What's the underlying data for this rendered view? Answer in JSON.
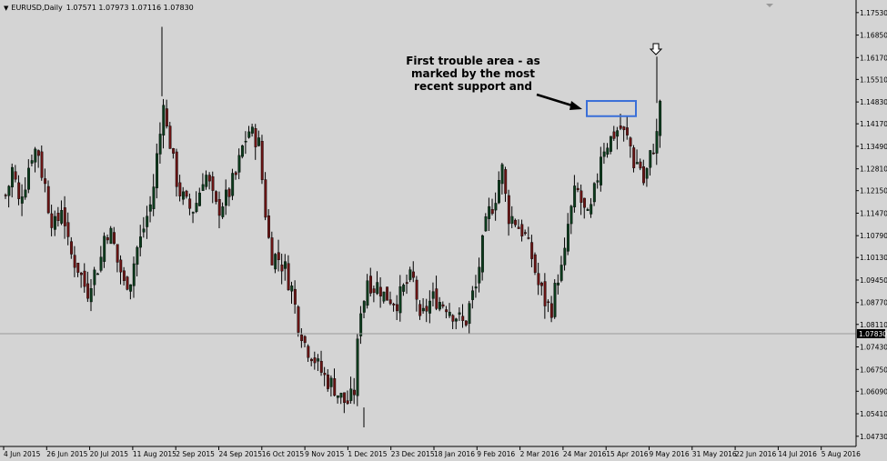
{
  "window": {
    "symbol_label": "EURUSD,Daily",
    "ohlc": [
      "1.07571",
      "1.07973",
      "1.07116",
      "1.07830"
    ]
  },
  "annotation": {
    "text": "First trouble area - as marked by the most recent support and"
  },
  "icons": {
    "arrow_down": "down-arrow-icon",
    "pointer_arrow": "pointer-arrow-icon",
    "title_triangle": "triangle-down-icon"
  },
  "colors": {
    "background": "#d4d4d4",
    "bull_candle": "#0b3b1c",
    "bear_candle": "#6a1414",
    "wick": "#000000",
    "highlight_box": "#3a6fd8",
    "current_price_line": "#9a9a9a",
    "current_price_tag": "#000000"
  },
  "chart_data": {
    "type": "candlestick",
    "symbol": "EURUSD",
    "timeframe": "Daily",
    "y_axis": {
      "range": [
        1.0445,
        1.178
      ],
      "tick_labels": [
        "1.17530",
        "1.16850",
        "1.16170",
        "1.15510",
        "1.14830",
        "1.14170",
        "1.13490",
        "1.12810",
        "1.12150",
        "1.11470",
        "1.10790",
        "1.10130",
        "1.09450",
        "1.08770",
        "1.08110",
        "1.07430",
        "1.06750",
        "1.06090",
        "1.05410",
        "1.04730"
      ]
    },
    "x_axis": {
      "tick_labels": [
        "4 Jun 2015",
        "26 Jun 2015",
        "20 Jul 2015",
        "11 Aug 2015",
        "2 Sep 2015",
        "24 Sep 2015",
        "16 Oct 2015",
        "9 Nov 2015",
        "1 Dec 2015",
        "23 Dec 2015",
        "18 Jan 2016",
        "9 Feb 2016",
        "2 Mar 2016",
        "24 Mar 2016",
        "15 Apr 2016",
        "9 May 2016",
        "31 May 2016",
        "22 Jun 2016",
        "14 Jul 2016",
        "5 Aug 2016"
      ]
    },
    "current_price": "1.07830",
    "highlight_zone": {
      "low": 1.1451,
      "high": 1.1475,
      "from": "24 Mar 2016",
      "to": "15 Apr 2016"
    },
    "close_path": [
      [
        0,
        1.12
      ],
      [
        5,
        1.128
      ],
      [
        10,
        1.118
      ],
      [
        15,
        1.124
      ],
      [
        20,
        1.132
      ],
      [
        25,
        1.135
      ],
      [
        30,
        1.125
      ],
      [
        35,
        1.115
      ],
      [
        40,
        1.11
      ],
      [
        45,
        1.117
      ],
      [
        50,
        1.105
      ],
      [
        55,
        1.1
      ],
      [
        60,
        1.097
      ],
      [
        65,
        1.09
      ],
      [
        70,
        1.096
      ],
      [
        75,
        1.099
      ],
      [
        80,
        1.11
      ],
      [
        85,
        1.108
      ],
      [
        90,
        1.1
      ],
      [
        95,
        1.093
      ],
      [
        100,
        1.095
      ],
      [
        105,
        1.103
      ],
      [
        110,
        1.109
      ],
      [
        115,
        1.115
      ],
      [
        120,
        1.125
      ],
      [
        125,
        1.142
      ],
      [
        126,
        1.161
      ],
      [
        127,
        1.15
      ],
      [
        130,
        1.14
      ],
      [
        135,
        1.13
      ],
      [
        140,
        1.121
      ],
      [
        145,
        1.118
      ],
      [
        150,
        1.115
      ],
      [
        155,
        1.12
      ],
      [
        160,
        1.127
      ],
      [
        165,
        1.122
      ],
      [
        170,
        1.115
      ],
      [
        175,
        1.118
      ],
      [
        180,
        1.121
      ],
      [
        185,
        1.126
      ],
      [
        190,
        1.133
      ],
      [
        195,
        1.14
      ],
      [
        200,
        1.138
      ],
      [
        205,
        1.135
      ],
      [
        210,
        1.11
      ],
      [
        215,
        1.102
      ],
      [
        220,
        1.101
      ],
      [
        225,
        1.098
      ],
      [
        230,
        1.092
      ],
      [
        235,
        1.083
      ],
      [
        240,
        1.076
      ],
      [
        245,
        1.073
      ],
      [
        250,
        1.07
      ],
      [
        255,
        1.066
      ],
      [
        260,
        1.064
      ],
      [
        265,
        1.062
      ],
      [
        270,
        1.059
      ],
      [
        275,
        1.057
      ],
      [
        280,
        1.06
      ],
      [
        283,
        1.063
      ],
      [
        285,
        1.086
      ],
      [
        288,
        1.087
      ],
      [
        292,
        1.095
      ],
      [
        296,
        1.092
      ],
      [
        300,
        1.093
      ],
      [
        305,
        1.09
      ],
      [
        310,
        1.089
      ],
      [
        315,
        1.088
      ],
      [
        320,
        1.091
      ],
      [
        325,
        1.095
      ],
      [
        330,
        1.094
      ],
      [
        333,
        1.08
      ],
      [
        336,
        1.083
      ],
      [
        340,
        1.087
      ],
      [
        345,
        1.089
      ],
      [
        350,
        1.088
      ],
      [
        355,
        1.087
      ],
      [
        360,
        1.085
      ],
      [
        365,
        1.083
      ],
      [
        370,
        1.081
      ],
      [
        375,
        1.088
      ],
      [
        380,
        1.093
      ],
      [
        385,
        1.108
      ],
      [
        390,
        1.115
      ],
      [
        395,
        1.12
      ],
      [
        400,
        1.128
      ],
      [
        405,
        1.114
      ],
      [
        410,
        1.113
      ],
      [
        415,
        1.11
      ],
      [
        420,
        1.107
      ],
      [
        425,
        1.1
      ],
      [
        430,
        1.093
      ],
      [
        435,
        1.088
      ],
      [
        440,
        1.086
      ],
      [
        445,
        1.095
      ],
      [
        450,
        1.099
      ],
      [
        455,
        1.114
      ],
      [
        460,
        1.122
      ],
      [
        465,
        1.117
      ],
      [
        470,
        1.112
      ],
      [
        475,
        1.121
      ],
      [
        480,
        1.133
      ],
      [
        485,
        1.136
      ],
      [
        490,
        1.138
      ],
      [
        495,
        1.141
      ],
      [
        500,
        1.138
      ],
      [
        505,
        1.134
      ],
      [
        508,
        1.128
      ],
      [
        510,
        1.132
      ],
      [
        515,
        1.124
      ],
      [
        518,
        1.129
      ],
      [
        521,
        1.133
      ],
      [
        524,
        1.136
      ],
      [
        526,
        1.14
      ],
      [
        528,
        1.149
      ],
      [
        530,
        1.153
      ]
    ],
    "annotation_text": "First trouble area - as marked by the most recent support and"
  }
}
